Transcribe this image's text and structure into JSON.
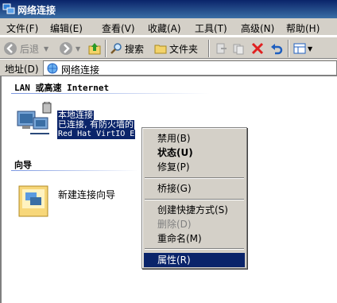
{
  "window": {
    "title": "网络连接"
  },
  "menu": [
    {
      "label": "文件(F)"
    },
    {
      "label": "编辑(E)"
    },
    {
      "label": "查看(V)"
    },
    {
      "label": "收藏(A)"
    },
    {
      "label": "工具(T)"
    },
    {
      "label": "高级(N)"
    },
    {
      "label": "帮助(H)"
    }
  ],
  "toolbar": {
    "back_label": "后退",
    "search_label": "搜索",
    "folders_label": "文件夹"
  },
  "address": {
    "label": "地址(D)",
    "value": "网络连接"
  },
  "groups": {
    "lan_header": "LAN 或高速 Internet",
    "wizard_header": "向导"
  },
  "connection": {
    "name": "本地连接",
    "status": "已连接, 有防火墙的",
    "device": "Red Hat VirtIO E"
  },
  "wizard": {
    "label": "新建连接向导"
  },
  "context_menu": [
    {
      "label": "禁用(B)"
    },
    {
      "label": "状态(U)"
    },
    {
      "label": "修复(P)"
    },
    {
      "label": "桥接(G)"
    },
    {
      "label": "创建快捷方式(S)"
    },
    {
      "label": "删除(D)"
    },
    {
      "label": "重命名(M)"
    },
    {
      "label": "属性(R)"
    }
  ]
}
